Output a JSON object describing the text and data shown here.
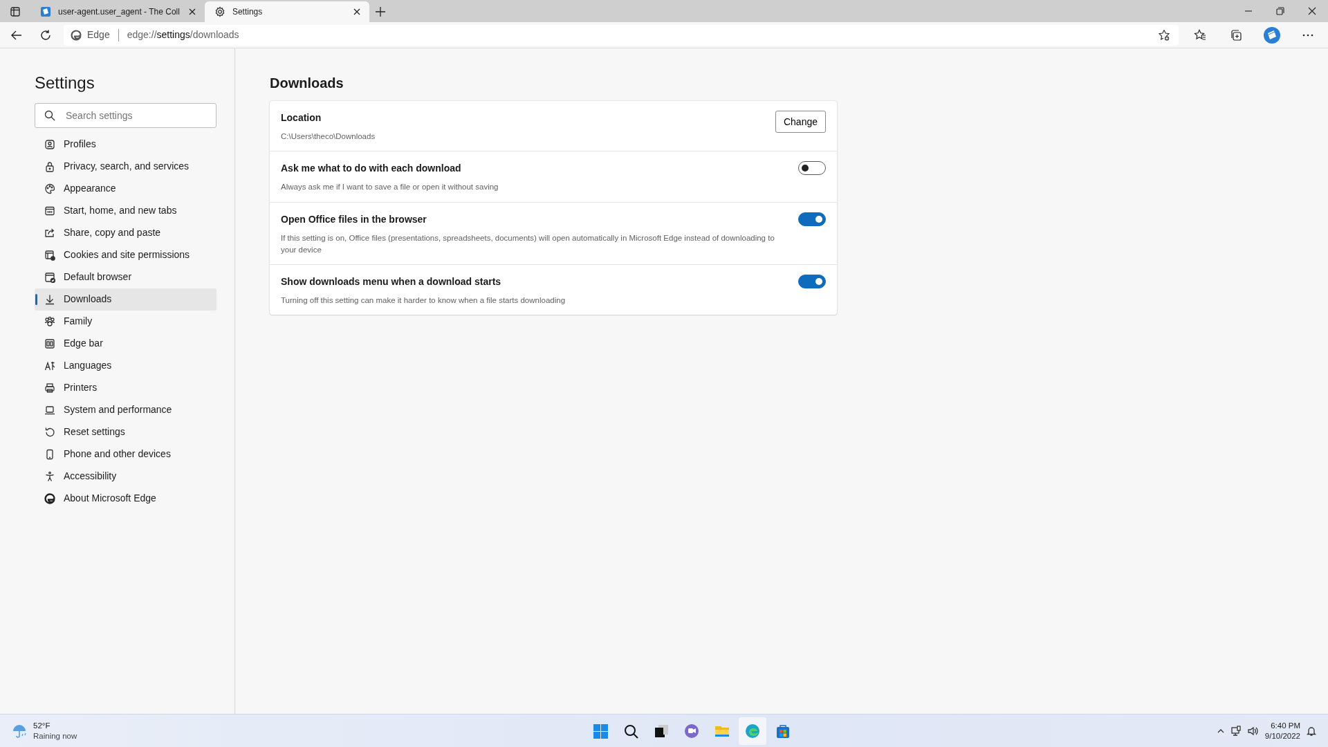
{
  "browser": {
    "tabs": [
      {
        "title": "user-agent.user_agent - The Coll",
        "selected": false
      },
      {
        "title": "Settings",
        "selected": true
      }
    ],
    "address": {
      "site": "Edge",
      "url_prefix": "edge://",
      "url_main": "settings",
      "url_suffix": "/downloads"
    }
  },
  "sidebar": {
    "title": "Settings",
    "search": {
      "placeholder": "Search settings"
    },
    "items": [
      {
        "label": "Profiles",
        "selected": false
      },
      {
        "label": "Privacy, search, and services",
        "selected": false
      },
      {
        "label": "Appearance",
        "selected": false
      },
      {
        "label": "Start, home, and new tabs",
        "selected": false
      },
      {
        "label": "Share, copy and paste",
        "selected": false
      },
      {
        "label": "Cookies and site permissions",
        "selected": false
      },
      {
        "label": "Default browser",
        "selected": false
      },
      {
        "label": "Downloads",
        "selected": true
      },
      {
        "label": "Family",
        "selected": false
      },
      {
        "label": "Edge bar",
        "selected": false
      },
      {
        "label": "Languages",
        "selected": false
      },
      {
        "label": "Printers",
        "selected": false
      },
      {
        "label": "System and performance",
        "selected": false
      },
      {
        "label": "Reset settings",
        "selected": false
      },
      {
        "label": "Phone and other devices",
        "selected": false
      },
      {
        "label": "Accessibility",
        "selected": false
      },
      {
        "label": "About Microsoft Edge",
        "selected": false
      }
    ]
  },
  "page": {
    "title": "Downloads",
    "settings": [
      {
        "kind": "button",
        "title": "Location",
        "description": "C:\\Users\\theco\\Downloads",
        "button": "Change"
      },
      {
        "kind": "toggle",
        "title": "Ask me what to do with each download",
        "description": "Always ask me if I want to save a file or open it without saving",
        "on": false
      },
      {
        "kind": "toggle",
        "title": "Open Office files in the browser",
        "description": "If this setting is on, Office files (presentations, spreadsheets, documents) will open automatically in Microsoft Edge instead of downloading to your device",
        "on": true
      },
      {
        "kind": "toggle",
        "title": "Show downloads menu when a download starts",
        "description": "Turning off this setting can make it harder to know when a file starts downloading",
        "on": true
      }
    ]
  },
  "taskbar": {
    "weather": {
      "temperature": "52°F",
      "condition": "Raining now"
    },
    "clock": {
      "time": "6:40 PM",
      "date": "9/10/2022"
    }
  }
}
